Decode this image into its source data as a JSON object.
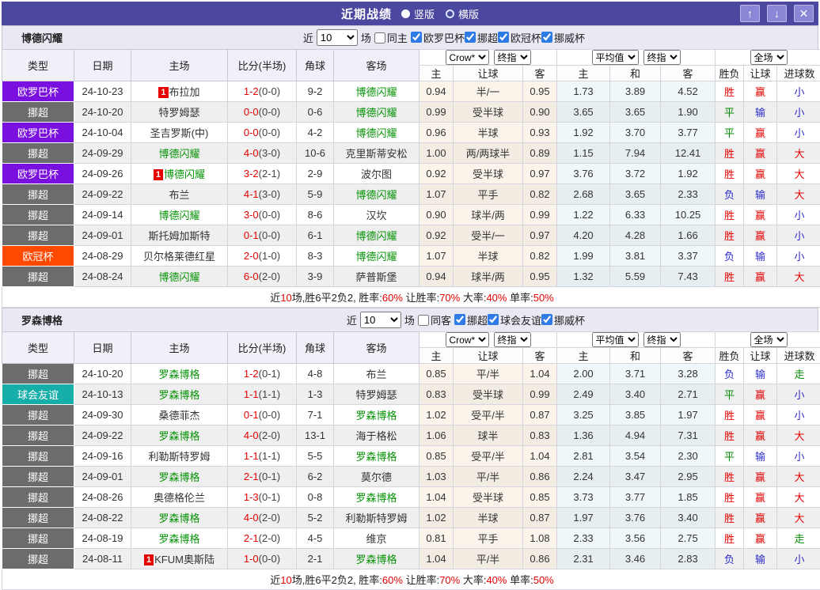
{
  "title_bar": {
    "title": "近期战绩",
    "radios": [
      {
        "label": "竖版",
        "selected": true
      },
      {
        "label": "横版",
        "selected": false
      }
    ],
    "buttons": {
      "up": "↑",
      "down": "↓",
      "close": "✕"
    }
  },
  "columns": [
    "类型",
    "日期",
    "主场",
    "比分(半场)",
    "角球",
    "客场"
  ],
  "subcolumns": [
    "主",
    "让球",
    "客",
    "主",
    "和",
    "客",
    "胜负",
    "让球",
    "进球数"
  ],
  "dropdowns": {
    "company": "Crow*",
    "final1": "终指",
    "average": "平均值",
    "final2": "终指",
    "scope": "全场"
  },
  "filter_labels": {
    "near": "近",
    "matches": "场"
  },
  "league_colors": {
    "欧罗巴杯": "#7A10E0",
    "挪超": "#6C6C6C",
    "欧冠杯": "#FF4800",
    "球会友谊": "#16AEA8",
    "挪威杯": "#6C6C6C"
  },
  "value_colors": {
    "胜": "#E60000",
    "平": "#008A00",
    "负": "#2B2BCC",
    "赢": "#E60000",
    "输": "#2B2BCC",
    "大": "#E60000",
    "小": "#2B2BCC",
    "走": "#008A00"
  },
  "sections": [
    {
      "team": "博德闪耀",
      "games": "10",
      "same_label": "同主",
      "same_checked": false,
      "leagues": [
        {
          "label": "欧罗巴杯",
          "checked": true
        },
        {
          "label": "挪超",
          "checked": true
        },
        {
          "label": "欧冠杯",
          "checked": true
        },
        {
          "label": "挪威杯",
          "checked": true
        }
      ],
      "rows": [
        {
          "lg": "欧罗巴杯",
          "date": "24-10-23",
          "home": "布拉加",
          "hc": 1,
          "hs": 0,
          "score": "1-2",
          "half": "(0-0)",
          "corner": "9-2",
          "away": "博德闪耀",
          "ac": 0,
          "as": 1,
          "o": [
            "0.94",
            "半/一",
            "0.95"
          ],
          "e": [
            "1.73",
            "3.89",
            "4.52"
          ],
          "r": [
            "胜",
            "赢",
            "小"
          ]
        },
        {
          "lg": "挪超",
          "date": "24-10-20",
          "home": "特罗姆瑟",
          "hc": 0,
          "hs": 0,
          "score": "0-0",
          "half": "(0-0)",
          "corner": "0-6",
          "away": "博德闪耀",
          "ac": 0,
          "as": 1,
          "o": [
            "0.99",
            "受半球",
            "0.90"
          ],
          "e": [
            "3.65",
            "3.65",
            "1.90"
          ],
          "r": [
            "平",
            "输",
            "小"
          ]
        },
        {
          "lg": "欧罗巴杯",
          "date": "24-10-04",
          "home": "圣吉罗斯(中)",
          "hc": 0,
          "hs": 0,
          "score": "0-0",
          "half": "(0-0)",
          "corner": "4-2",
          "away": "博德闪耀",
          "ac": 0,
          "as": 1,
          "o": [
            "0.96",
            "半球",
            "0.93"
          ],
          "e": [
            "1.92",
            "3.70",
            "3.77"
          ],
          "r": [
            "平",
            "赢",
            "小"
          ]
        },
        {
          "lg": "挪超",
          "date": "24-09-29",
          "home": "博德闪耀",
          "hc": 0,
          "hs": 1,
          "score": "4-0",
          "half": "(3-0)",
          "corner": "10-6",
          "away": "克里斯蒂安松",
          "ac": 0,
          "as": 0,
          "o": [
            "1.00",
            "两/两球半",
            "0.89"
          ],
          "e": [
            "1.15",
            "7.94",
            "12.41"
          ],
          "r": [
            "胜",
            "赢",
            "大"
          ]
        },
        {
          "lg": "欧罗巴杯",
          "date": "24-09-26",
          "home": "博德闪耀",
          "hc": 1,
          "hs": 1,
          "score": "3-2",
          "half": "(2-1)",
          "corner": "2-9",
          "away": "波尔图",
          "ac": 0,
          "as": 0,
          "o": [
            "0.92",
            "受半球",
            "0.97"
          ],
          "e": [
            "3.76",
            "3.72",
            "1.92"
          ],
          "r": [
            "胜",
            "赢",
            "大"
          ]
        },
        {
          "lg": "挪超",
          "date": "24-09-22",
          "home": "布兰",
          "hc": 0,
          "hs": 0,
          "score": "4-1",
          "half": "(3-0)",
          "corner": "5-9",
          "away": "博德闪耀",
          "ac": 0,
          "as": 1,
          "o": [
            "1.07",
            "平手",
            "0.82"
          ],
          "e": [
            "2.68",
            "3.65",
            "2.33"
          ],
          "r": [
            "负",
            "输",
            "大"
          ]
        },
        {
          "lg": "挪超",
          "date": "24-09-14",
          "home": "博德闪耀",
          "hc": 0,
          "hs": 1,
          "score": "3-0",
          "half": "(0-0)",
          "corner": "8-6",
          "away": "汉坎",
          "ac": 0,
          "as": 0,
          "o": [
            "0.90",
            "球半/两",
            "0.99"
          ],
          "e": [
            "1.22",
            "6.33",
            "10.25"
          ],
          "r": [
            "胜",
            "赢",
            "小"
          ]
        },
        {
          "lg": "挪超",
          "date": "24-09-01",
          "home": "斯托姆加斯特",
          "hc": 0,
          "hs": 0,
          "score": "0-1",
          "half": "(0-0)",
          "corner": "6-1",
          "away": "博德闪耀",
          "ac": 0,
          "as": 1,
          "o": [
            "0.92",
            "受半/一",
            "0.97"
          ],
          "e": [
            "4.20",
            "4.28",
            "1.66"
          ],
          "r": [
            "胜",
            "赢",
            "小"
          ]
        },
        {
          "lg": "欧冠杯",
          "date": "24-08-29",
          "home": "贝尔格莱德红星",
          "hc": 0,
          "hs": 0,
          "score": "2-0",
          "half": "(1-0)",
          "corner": "8-3",
          "away": "博德闪耀",
          "ac": 0,
          "as": 1,
          "o": [
            "1.07",
            "半球",
            "0.82"
          ],
          "e": [
            "1.99",
            "3.81",
            "3.37"
          ],
          "r": [
            "负",
            "输",
            "小"
          ]
        },
        {
          "lg": "挪超",
          "date": "24-08-24",
          "home": "博德闪耀",
          "hc": 0,
          "hs": 1,
          "score": "6-0",
          "half": "(2-0)",
          "corner": "3-9",
          "away": "萨普斯堡",
          "ac": 0,
          "as": 0,
          "o": [
            "0.94",
            "球半/两",
            "0.95"
          ],
          "e": [
            "1.32",
            "5.59",
            "7.43"
          ],
          "r": [
            "胜",
            "赢",
            "大"
          ]
        }
      ],
      "footer": [
        [
          "近",
          0
        ],
        [
          "10",
          1
        ],
        [
          "场,胜6平2负2, 胜率:",
          0
        ],
        [
          "60%",
          1
        ],
        [
          " 让胜率:",
          0
        ],
        [
          "70%",
          1
        ],
        [
          " 大率:",
          0
        ],
        [
          "40%",
          1
        ],
        [
          " 单率:",
          0
        ],
        [
          "50%",
          1
        ]
      ]
    },
    {
      "team": "罗森博格",
      "games": "10",
      "same_label": "同客",
      "same_checked": false,
      "leagues": [
        {
          "label": "挪超",
          "checked": true
        },
        {
          "label": "球会友谊",
          "checked": true
        },
        {
          "label": "挪威杯",
          "checked": true
        }
      ],
      "rows": [
        {
          "lg": "挪超",
          "date": "24-10-20",
          "home": "罗森博格",
          "hc": 0,
          "hs": 1,
          "score": "1-2",
          "half": "(0-1)",
          "corner": "4-8",
          "away": "布兰",
          "ac": 0,
          "as": 0,
          "o": [
            "0.85",
            "平/半",
            "1.04"
          ],
          "e": [
            "2.00",
            "3.71",
            "3.28"
          ],
          "r": [
            "负",
            "输",
            "走"
          ]
        },
        {
          "lg": "球会友谊",
          "date": "24-10-13",
          "home": "罗森博格",
          "hc": 0,
          "hs": 1,
          "score": "1-1",
          "half": "(1-1)",
          "corner": "1-3",
          "away": "特罗姆瑟",
          "ac": 0,
          "as": 0,
          "o": [
            "0.83",
            "受半球",
            "0.99"
          ],
          "e": [
            "2.49",
            "3.40",
            "2.71"
          ],
          "r": [
            "平",
            "赢",
            "小"
          ]
        },
        {
          "lg": "挪超",
          "date": "24-09-30",
          "home": "桑德菲杰",
          "hc": 0,
          "hs": 0,
          "score": "0-1",
          "half": "(0-0)",
          "corner": "7-1",
          "away": "罗森博格",
          "ac": 0,
          "as": 1,
          "o": [
            "1.02",
            "受平/半",
            "0.87"
          ],
          "e": [
            "3.25",
            "3.85",
            "1.97"
          ],
          "r": [
            "胜",
            "赢",
            "小"
          ]
        },
        {
          "lg": "挪超",
          "date": "24-09-22",
          "home": "罗森博格",
          "hc": 0,
          "hs": 1,
          "score": "4-0",
          "half": "(2-0)",
          "corner": "13-1",
          "away": "海于格松",
          "ac": 0,
          "as": 0,
          "o": [
            "1.06",
            "球半",
            "0.83"
          ],
          "e": [
            "1.36",
            "4.94",
            "7.31"
          ],
          "r": [
            "胜",
            "赢",
            "大"
          ]
        },
        {
          "lg": "挪超",
          "date": "24-09-16",
          "home": "利勒斯特罗姆",
          "hc": 0,
          "hs": 0,
          "score": "1-1",
          "half": "(1-1)",
          "corner": "5-5",
          "away": "罗森博格",
          "ac": 0,
          "as": 1,
          "o": [
            "0.85",
            "受平/半",
            "1.04"
          ],
          "e": [
            "2.81",
            "3.54",
            "2.30"
          ],
          "r": [
            "平",
            "输",
            "小"
          ]
        },
        {
          "lg": "挪超",
          "date": "24-09-01",
          "home": "罗森博格",
          "hc": 0,
          "hs": 1,
          "score": "2-1",
          "half": "(0-1)",
          "corner": "6-2",
          "away": "莫尔德",
          "ac": 0,
          "as": 0,
          "o": [
            "1.03",
            "平/半",
            "0.86"
          ],
          "e": [
            "2.24",
            "3.47",
            "2.95"
          ],
          "r": [
            "胜",
            "赢",
            "大"
          ]
        },
        {
          "lg": "挪超",
          "date": "24-08-26",
          "home": "奥德格伦兰",
          "hc": 0,
          "hs": 0,
          "score": "1-3",
          "half": "(0-1)",
          "corner": "0-8",
          "away": "罗森博格",
          "ac": 0,
          "as": 1,
          "o": [
            "1.04",
            "受半球",
            "0.85"
          ],
          "e": [
            "3.73",
            "3.77",
            "1.85"
          ],
          "r": [
            "胜",
            "赢",
            "大"
          ]
        },
        {
          "lg": "挪超",
          "date": "24-08-22",
          "home": "罗森博格",
          "hc": 0,
          "hs": 1,
          "score": "4-0",
          "half": "(2-0)",
          "corner": "5-2",
          "away": "利勒斯特罗姆",
          "ac": 0,
          "as": 0,
          "o": [
            "1.02",
            "半球",
            "0.87"
          ],
          "e": [
            "1.97",
            "3.76",
            "3.40"
          ],
          "r": [
            "胜",
            "赢",
            "大"
          ]
        },
        {
          "lg": "挪超",
          "date": "24-08-19",
          "home": "罗森博格",
          "hc": 0,
          "hs": 1,
          "score": "2-1",
          "half": "(2-0)",
          "corner": "4-5",
          "away": "维京",
          "ac": 0,
          "as": 0,
          "o": [
            "0.81",
            "平手",
            "1.08"
          ],
          "e": [
            "2.33",
            "3.56",
            "2.75"
          ],
          "r": [
            "胜",
            "赢",
            "走"
          ]
        },
        {
          "lg": "挪超",
          "date": "24-08-11",
          "home": "KFUM奥斯陆",
          "hc": 1,
          "hs": 0,
          "score": "1-0",
          "half": "(0-0)",
          "corner": "2-1",
          "away": "罗森博格",
          "ac": 0,
          "as": 1,
          "o": [
            "1.04",
            "平/半",
            "0.86"
          ],
          "e": [
            "2.31",
            "3.46",
            "2.83"
          ],
          "r": [
            "负",
            "输",
            "小"
          ]
        }
      ],
      "footer": [
        [
          "近",
          0
        ],
        [
          "10",
          1
        ],
        [
          "场,胜6平2负2, 胜率:",
          0
        ],
        [
          "60%",
          1
        ],
        [
          " 让胜率:",
          0
        ],
        [
          "70%",
          1
        ],
        [
          " 大率:",
          0
        ],
        [
          "40%",
          1
        ],
        [
          " 单率:",
          0
        ],
        [
          "50%",
          1
        ]
      ]
    }
  ]
}
